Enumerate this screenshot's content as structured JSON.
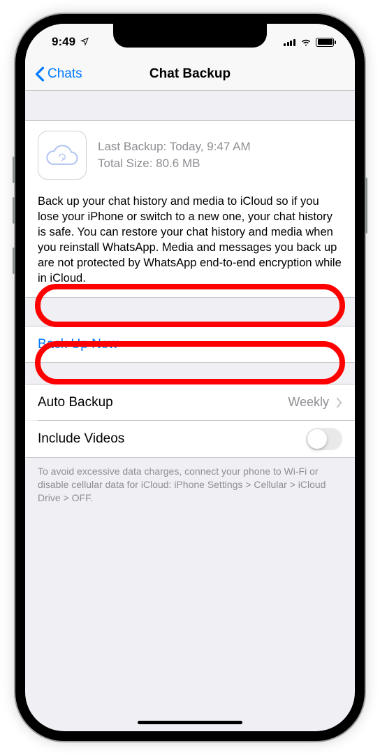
{
  "status": {
    "time": "9:49"
  },
  "nav": {
    "back": "Chats",
    "title": "Chat Backup"
  },
  "info": {
    "last_backup_label": "Last Backup:",
    "last_backup_value": "Today, 9:47 AM",
    "size_label": "Total Size:",
    "size_value": "80.6 MB",
    "description": "Back up your chat history and media to iCloud so if you lose your iPhone or switch to a new one, your chat history is safe. You can restore your chat history and media when you reinstall WhatsApp. Media and messages you back up are not protected by WhatsApp end-to-end encryption while in iCloud."
  },
  "rows": {
    "backup_now": "Back Up Now",
    "auto_backup_label": "Auto Backup",
    "auto_backup_value": "Weekly",
    "include_videos": "Include Videos"
  },
  "footer": "To avoid excessive data charges, connect your phone to Wi-Fi or disable cellular data for iCloud: iPhone Settings > Cellular > iCloud Drive > OFF.",
  "highlight_color": "#ff0000"
}
